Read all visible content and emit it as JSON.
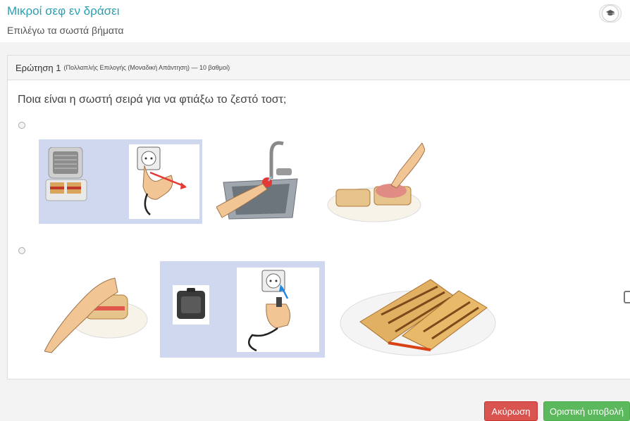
{
  "header": {
    "title": "Μικροί σεφ εν δράσει",
    "subtitle": "Επιλέγω τα σωστά βήματα",
    "cap_icon": "graduation-cap-icon"
  },
  "question": {
    "label": "Ερώτηση 1",
    "meta": "(Πολλαπλής Επιλογής (Μοναδική Απάντηση) — 10 βαθμοί)",
    "text": "Ποια είναι η σωστή σειρά για να φτιάξω το ζεστό τοστ;"
  },
  "options": [
    {
      "illustrations": [
        "sandwich-maker-with-toast",
        "unplugging-power-cord",
        "washing-tomato-in-sink",
        "placing-ham-on-bread"
      ]
    },
    {
      "illustrations": [
        "pressing-sandwich",
        "closed-sandwich-maker",
        "plugging-in-power-cord",
        "grilled-toast-on-plate"
      ]
    }
  ],
  "actions": {
    "cancel_label": "Ακύρωση",
    "submit_label": "Οριστική υποβολή"
  },
  "colors": {
    "title": "#2a9fb0",
    "cancel": "#d9534f",
    "submit": "#5cb85c",
    "highlight_box": "#cfd8ef"
  }
}
